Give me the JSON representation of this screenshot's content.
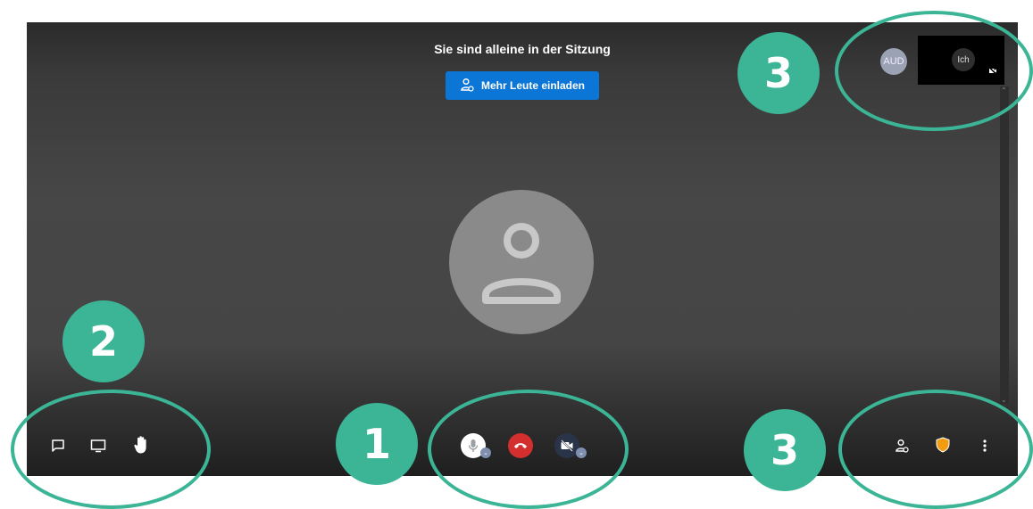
{
  "meeting": {
    "title": "Sie sind alleine in der Sitzung",
    "invite_button_label": "Mehr Leute einladen"
  },
  "filmstrip": {
    "remote_participant_initials": "AUD",
    "self_label": "Ich"
  },
  "toolbar": {
    "left": [
      "chat-icon",
      "screen-share-icon",
      "raise-hand-icon"
    ],
    "center": [
      "microphone-icon",
      "hangup-icon",
      "camera-off-icon"
    ],
    "right": [
      "invite-icon",
      "security-shield-icon",
      "more-options-icon"
    ]
  },
  "annotations": {
    "badge_center": "1",
    "badge_left": "2",
    "badge_top_right": "3",
    "badge_bottom_right": "3"
  },
  "colors": {
    "invite_button": "#0b76d6",
    "hangup": "#d32f2f",
    "annotation_green": "#3bb596",
    "shield": "#f39c12"
  }
}
